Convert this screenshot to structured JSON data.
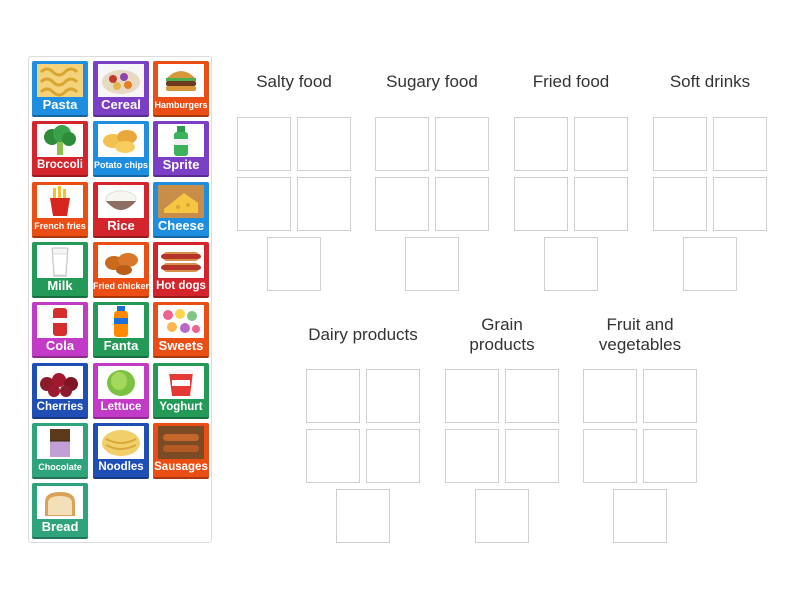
{
  "tiles": [
    {
      "label": "Pasta",
      "color": "#1e8fe0",
      "icon": "pasta-icon"
    },
    {
      "label": "Cereal",
      "color": "#7a3fc4",
      "icon": "cereal-icon"
    },
    {
      "label": "Hamburgers",
      "color": "#ea4e14",
      "icon": "hamburger-icon"
    },
    {
      "label": "Broccoli",
      "color": "#d4242c",
      "icon": "broccoli-icon"
    },
    {
      "label": "Potato chips",
      "color": "#1e8fe0",
      "icon": "potato-chips-icon"
    },
    {
      "label": "Sprite",
      "color": "#7a3fc4",
      "icon": "sprite-bottle-icon"
    },
    {
      "label": "French fries",
      "color": "#ea4e14",
      "icon": "french-fries-icon"
    },
    {
      "label": "Rice",
      "color": "#d4242c",
      "icon": "rice-icon"
    },
    {
      "label": "Cheese",
      "color": "#1e8fe0",
      "icon": "cheese-icon"
    },
    {
      "label": "Milk",
      "color": "#239a58",
      "icon": "milk-icon"
    },
    {
      "label": "Fried chicken",
      "color": "#ea4e14",
      "icon": "fried-chicken-icon"
    },
    {
      "label": "Hot dogs",
      "color": "#d4242c",
      "icon": "hot-dog-icon"
    },
    {
      "label": "Cola",
      "color": "#c23bc6",
      "icon": "cola-icon"
    },
    {
      "label": "Fanta",
      "color": "#239a58",
      "icon": "fanta-icon"
    },
    {
      "label": "Sweets",
      "color": "#ea4e14",
      "icon": "sweets-icon"
    },
    {
      "label": "Cherries",
      "color": "#1f4fb5",
      "icon": "cherries-icon"
    },
    {
      "label": "Lettuce",
      "color": "#c23bc6",
      "icon": "lettuce-icon"
    },
    {
      "label": "Yoghurt",
      "color": "#239a58",
      "icon": "yoghurt-icon"
    },
    {
      "label": "Chocolate",
      "color": "#2fa47c",
      "icon": "chocolate-icon"
    },
    {
      "label": "Noodles",
      "color": "#1f4fb5",
      "icon": "noodles-icon"
    },
    {
      "label": "Sausages",
      "color": "#ea4e14",
      "icon": "sausages-icon"
    },
    {
      "label": "Bread",
      "color": "#2fa47c",
      "icon": "bread-icon"
    }
  ],
  "categories": [
    {
      "title": "Salty food"
    },
    {
      "title": "Sugary food"
    },
    {
      "title": "Fried food"
    },
    {
      "title": "Soft drinks"
    },
    {
      "title": "Dairy products"
    },
    {
      "title": "Grain\nproducts"
    },
    {
      "title": "Fruit and\nvegetables"
    }
  ]
}
